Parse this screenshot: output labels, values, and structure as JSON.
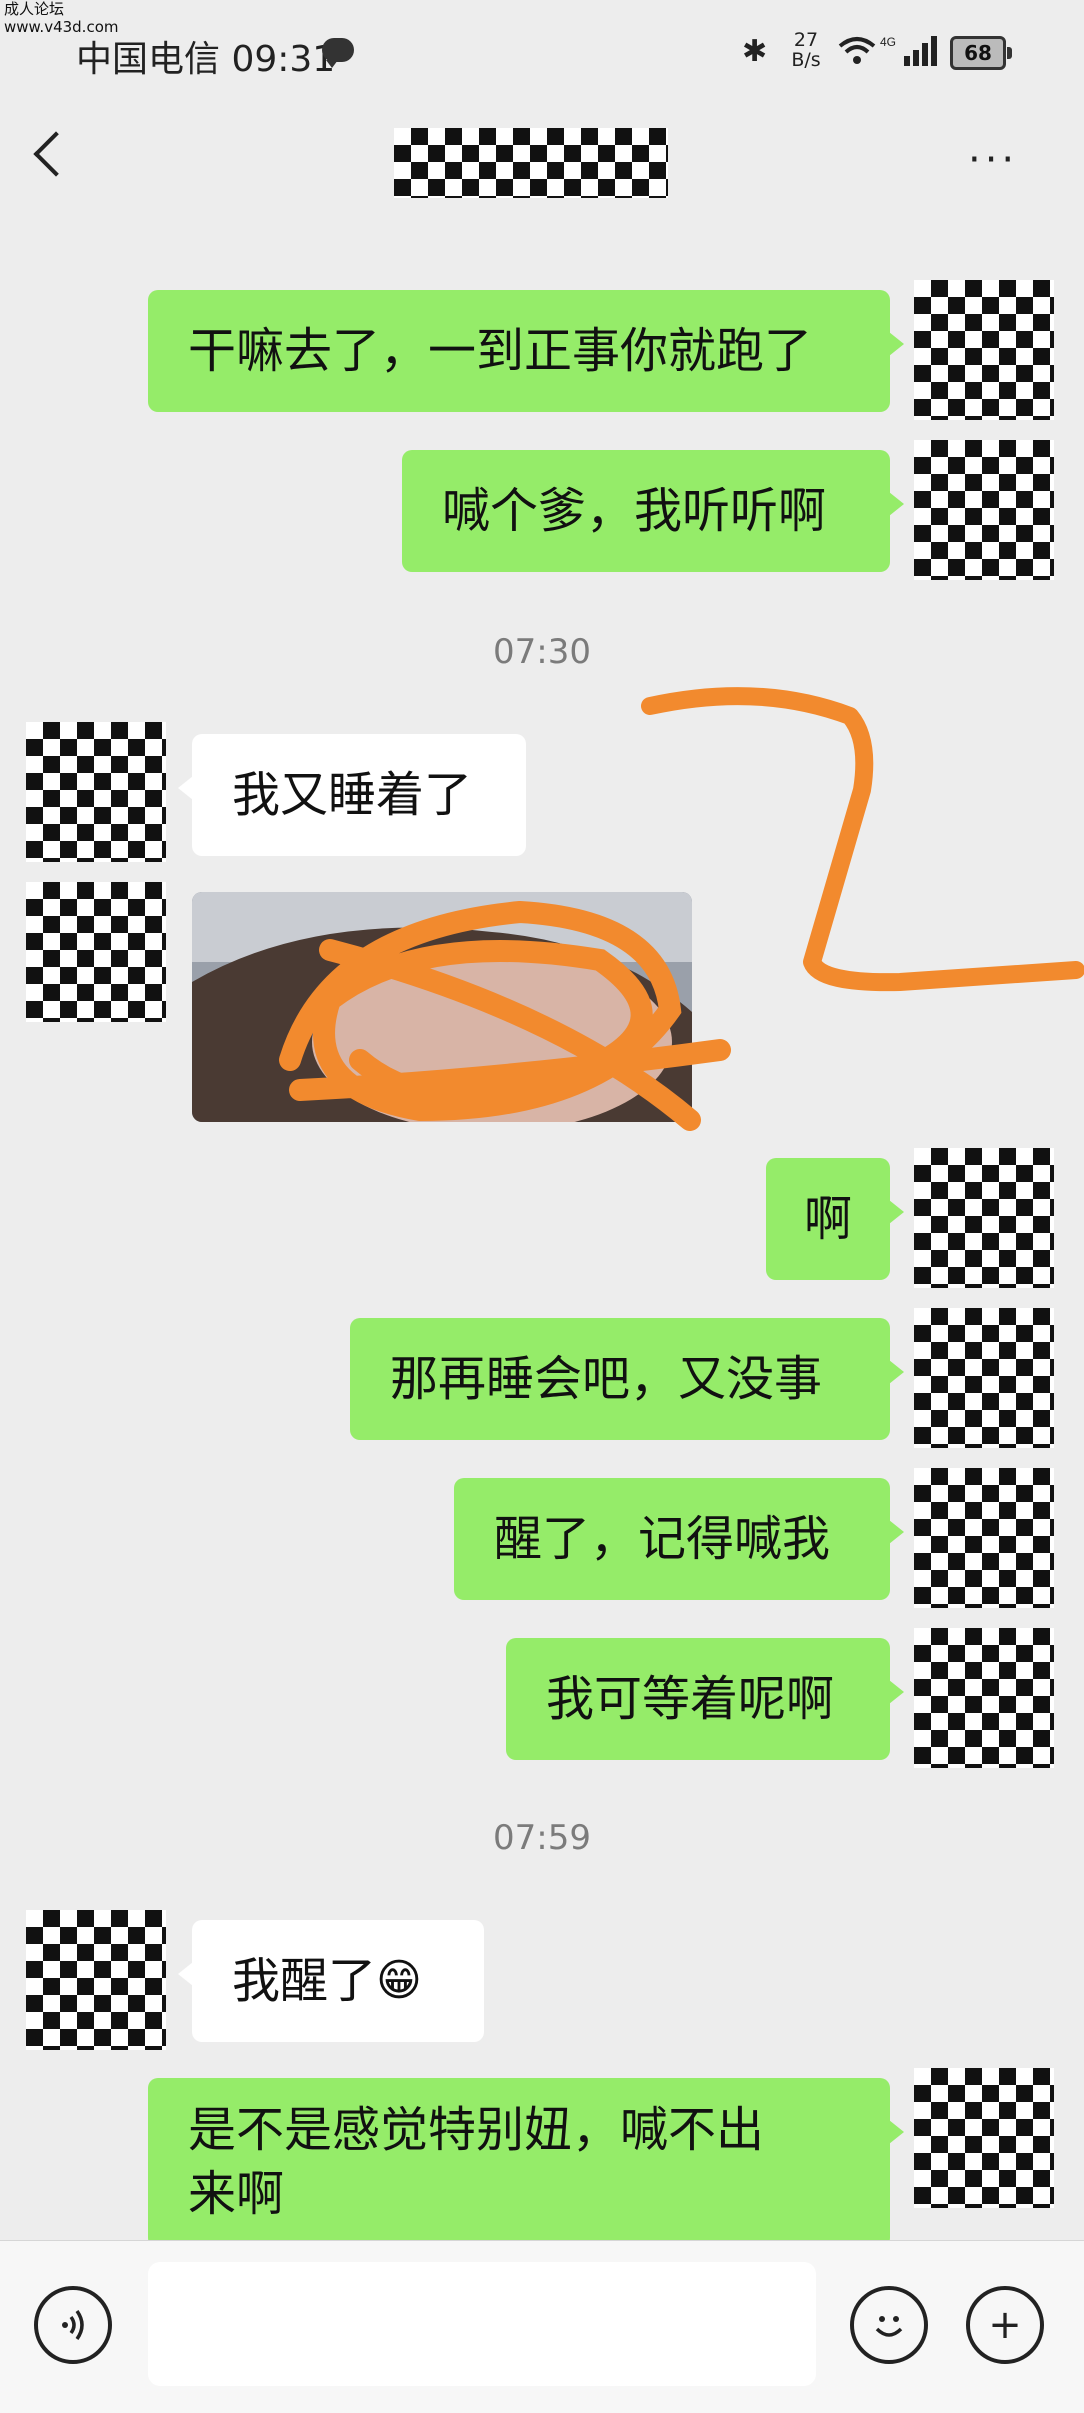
{
  "status_bar": {
    "site_watermark_line1": "成人论坛",
    "site_watermark_line2": "www.v43d.com",
    "carrier_time": "中国电信 09:31",
    "net_speed_value": "27",
    "net_speed_unit": "B/s",
    "network_type": "4G",
    "battery": "68"
  },
  "header": {
    "back_icon": "chevron-left-icon",
    "more_icon": "more-dots-icon",
    "more_label": "···"
  },
  "messages": [
    {
      "side": "out",
      "text": "干嘛去了，一到正事你就跑了"
    },
    {
      "side": "out",
      "text": "喊个爹，我听听啊"
    },
    {
      "side": "time",
      "text": "07:30"
    },
    {
      "side": "in",
      "text": "我又睡着了"
    },
    {
      "side": "in",
      "type": "image"
    },
    {
      "side": "out",
      "text": "啊"
    },
    {
      "side": "out",
      "text": "那再睡会吧，又没事"
    },
    {
      "side": "out",
      "text": "醒了，记得喊我"
    },
    {
      "side": "out",
      "text": "我可等着呢啊"
    },
    {
      "side": "time",
      "text": "07:59"
    },
    {
      "side": "in",
      "text": "我醒了",
      "emoji": "😁"
    },
    {
      "side": "out",
      "text": "是不是感觉特别妞，喊不出来啊"
    }
  ],
  "bottom_bar": {
    "voice_icon": "voice-icon",
    "emoji_icon": "emoji-icon",
    "plus_icon": "plus-icon",
    "plus_label": "+"
  },
  "colors": {
    "background": "#ededed",
    "outgoing_bubble": "#95ec69",
    "incoming_bubble": "#ffffff",
    "scribble": "#f28a2e"
  }
}
